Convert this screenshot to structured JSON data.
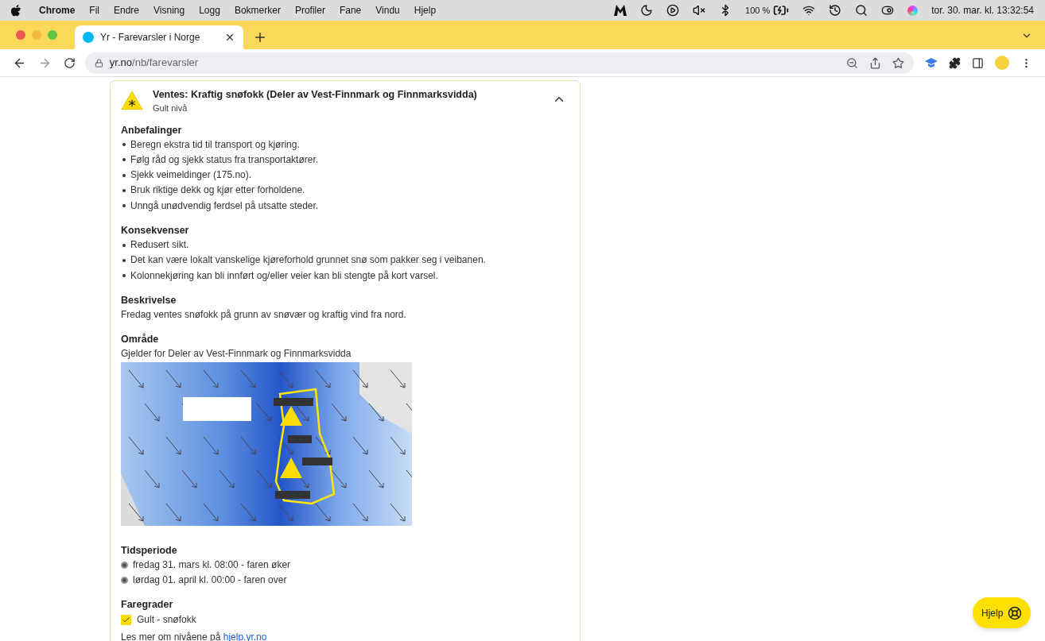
{
  "menubar": {
    "app": "Chrome",
    "menus": [
      "Fil",
      "Endre",
      "Visning",
      "Logg",
      "Bokmerker",
      "Profiler",
      "Fane",
      "Vindu",
      "Hjelp"
    ],
    "battery": "100 %",
    "clock": "tor. 30. mar. kl. 13:32:54"
  },
  "tabs": [
    {
      "title": "Yr - Farevarsler i Norge",
      "selected": true
    }
  ],
  "address": {
    "host": "yr.no",
    "path": "/nb/farevarsler"
  },
  "warning": {
    "title": "Ventes: Kraftig snøfokk (Deler av Vest-Finnmark og Finnmarksvidda)",
    "level_label": "Gult nivå",
    "expanded": true,
    "sections": [
      {
        "kind": "list",
        "heading": "Anbefalinger",
        "items": [
          "Beregn ekstra tid til transport og kjøring.",
          "Følg råd og sjekk status fra transportaktører.",
          "Sjekk veimeldinger (175.no).",
          "Bruk riktige dekk og kjør etter forholdene.",
          "Unngå unødvendig ferdsel på utsatte steder."
        ]
      },
      {
        "kind": "list",
        "heading": "Konsekvenser",
        "items": [
          "Redusert sikt.",
          "Det kan være lokalt vanskelige kjøreforhold grunnet snø som pakker seg i veibanen.",
          "Kolonnekjøring kan bli innført og/eller veier kan bli stengte på kort varsel."
        ]
      },
      {
        "kind": "text",
        "heading": "Beskrivelse",
        "text": "Fredag ventes snøfokk på grunn av snøvær og kraftig vind fra nord."
      },
      {
        "kind": "map",
        "heading": "Område",
        "text": "Gjelder for Deler av Vest-Finnmark og Finnmarksvidda"
      },
      {
        "kind": "timeline",
        "heading": "Tidsperiode",
        "items": [
          "fredag 31. mars kl. 08:00 - faren øker",
          "lørdag 01. april kl. 00:00 - faren over"
        ]
      },
      {
        "kind": "levels",
        "heading": "Faregrader",
        "items": [
          {
            "label": "Gult - snøfokk",
            "checked": true
          }
        ],
        "note": "Les mer om nivåene på ",
        "link": "hjelp.yr.no"
      }
    ]
  },
  "help_button": "Hjelp"
}
